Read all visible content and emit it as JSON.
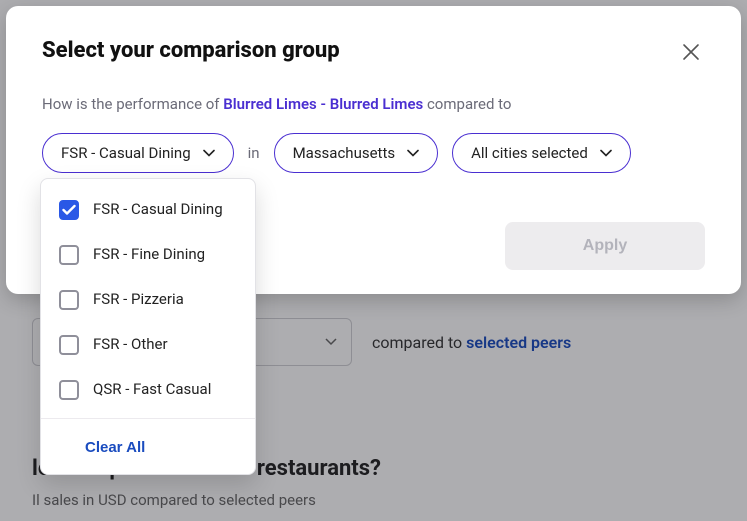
{
  "modal": {
    "title": "Select your comparison group",
    "lead_prefix": "How is the performance of ",
    "brand": "Blurred Limes - Blurred Limes",
    "lead_suffix": " compared to",
    "in_text": "in",
    "apply_label": "Apply",
    "filters": {
      "segment": "FSR - Casual Dining",
      "region": "Massachusetts",
      "cities": "All cities selected"
    }
  },
  "dropdown": {
    "options": [
      {
        "label": "FSR - Casual Dining",
        "checked": true
      },
      {
        "label": "FSR - Fine Dining",
        "checked": false
      },
      {
        "label": "FSR - Pizzeria",
        "checked": false
      },
      {
        "label": "FSR - Other",
        "checked": false
      },
      {
        "label": "QSR - Fast Casual",
        "checked": false
      }
    ],
    "clear_label": "Clear All"
  },
  "background": {
    "compared_prefix": "compared to ",
    "compared_link": "selected peers",
    "heading": "les compare to similar restaurants?",
    "sub": "Il sales in USD compared to selected peers"
  }
}
